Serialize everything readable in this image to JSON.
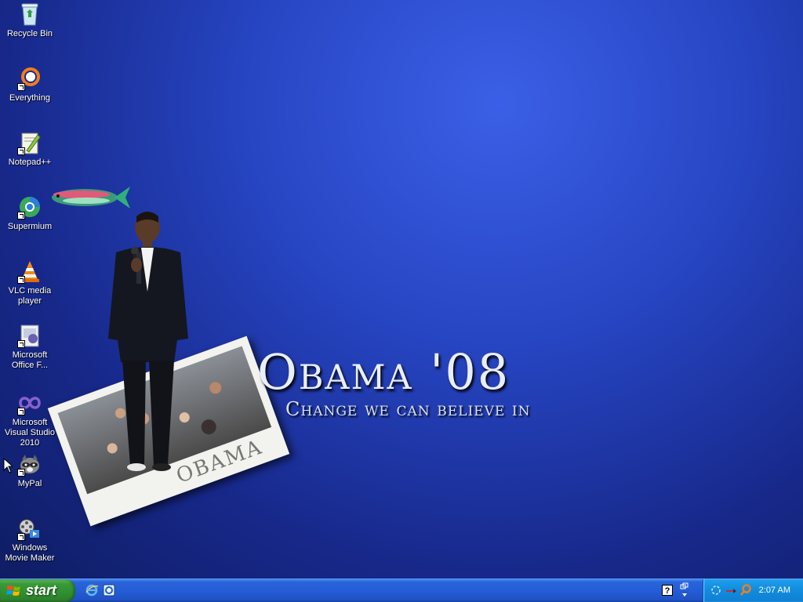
{
  "desktop": {
    "icons": [
      {
        "label": "Recycle Bin"
      },
      {
        "label": "Everything"
      },
      {
        "label": "Notepad++"
      },
      {
        "label": "Supermium"
      },
      {
        "label": "VLC media player"
      },
      {
        "label": "Microsoft Office F..."
      },
      {
        "label": "Microsoft Visual Studio 2010"
      },
      {
        "label": "MyPal"
      },
      {
        "label": "Windows Movie Maker"
      }
    ],
    "wallpaper": {
      "title": "Obama '08",
      "subtitle": "Change we can  believe in",
      "photo_caption": "OBAMA"
    }
  },
  "taskbar": {
    "start_label": "start",
    "help_glyph": "?",
    "clock": "2:07 AM"
  },
  "colors": {
    "desktop_blue": "#2746c4",
    "taskbar_blue": "#245dd7",
    "start_green": "#3a9a3a",
    "tray_blue": "#138ee0"
  }
}
